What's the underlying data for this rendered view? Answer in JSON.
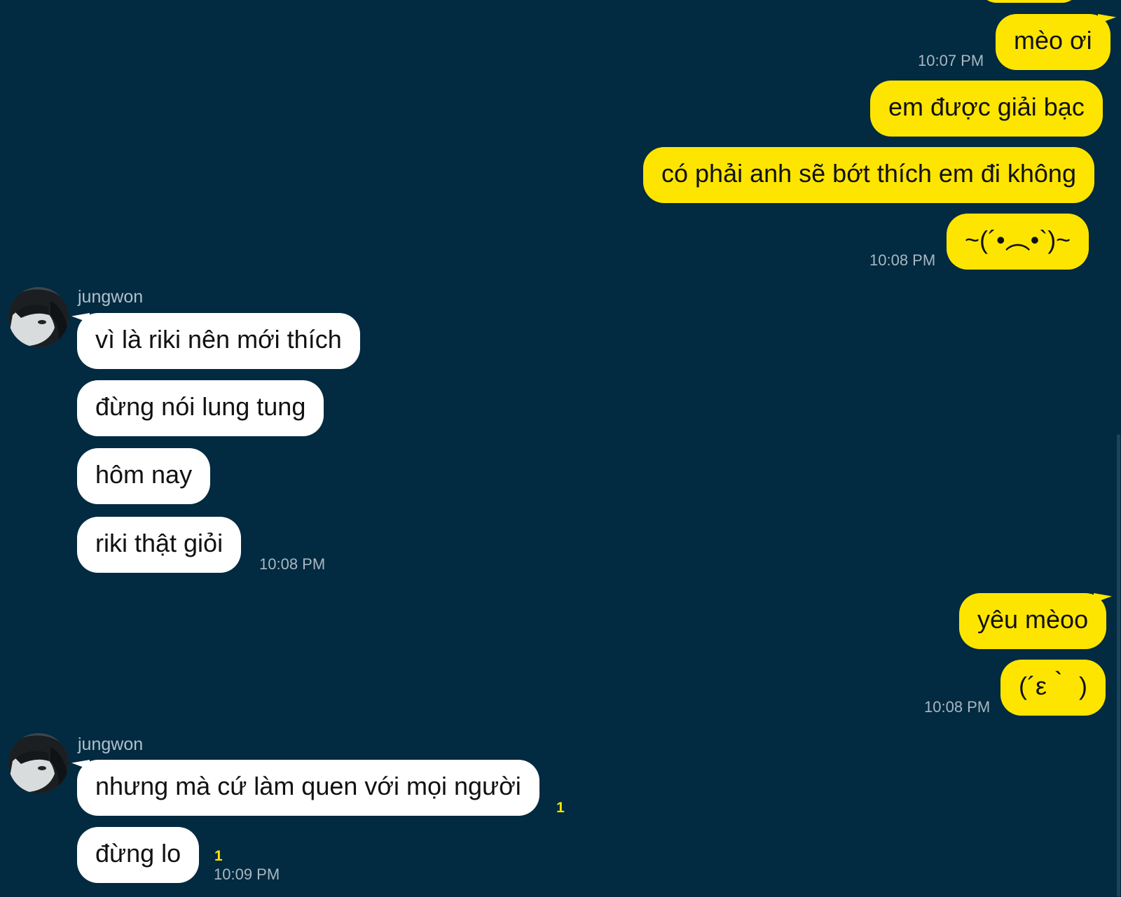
{
  "messages": {
    "m1": "mèo ơi",
    "m2": "em được giải bạc",
    "m3": "có phải anh sẽ bớt thích em đi không",
    "m4": "~(´•︵•`)~",
    "m5": "vì là riki nên mới thích",
    "m6": "đừng nói lung tung",
    "m7": "hôm nay",
    "m8": "riki thật giỏi",
    "m9": "yêu mèoo",
    "m10": "(´ε｀ )",
    "m11": "nhưng mà cứ làm quen với mọi người",
    "m12": "đừng lo"
  },
  "times": {
    "t1": "10:07 PM",
    "t2": "10:08 PM",
    "t3": "10:08 PM",
    "t4": "10:08 PM",
    "t5": "10:09 PM"
  },
  "unread": {
    "u1": "1",
    "u2": "1"
  },
  "sender": {
    "name1": "jungwon",
    "name2": "jungwon"
  },
  "colors": {
    "background": "#022a40",
    "outgoing_bubble": "#fee500",
    "incoming_bubble": "#ffffff",
    "unread_count": "#fee500"
  }
}
